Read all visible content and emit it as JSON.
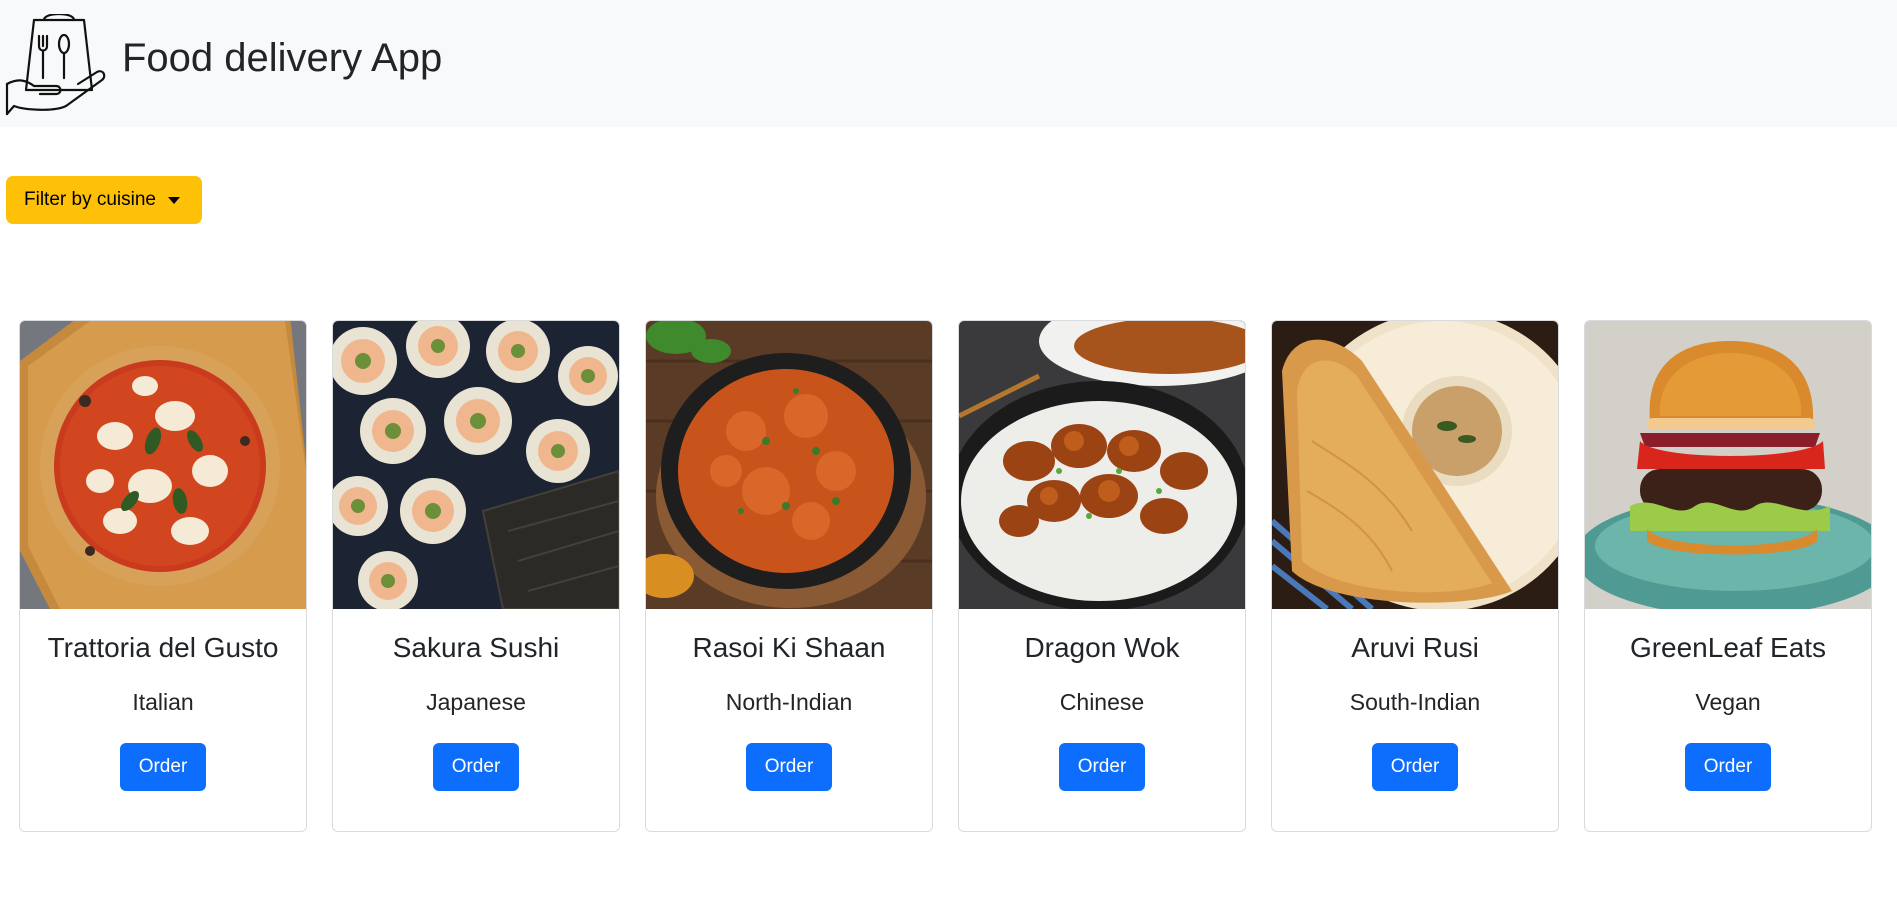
{
  "navbar": {
    "title": "Food delivery App",
    "logo_icon": "hand-holding-food-bag-icon"
  },
  "filter": {
    "label": "Filter by cuisine",
    "color": "#ffc107"
  },
  "restaurants": [
    {
      "name": "Trattoria del Gusto",
      "cuisine": "Italian",
      "order_label": "Order",
      "image": "pizza-image"
    },
    {
      "name": "Sakura Sushi",
      "cuisine": "Japanese",
      "order_label": "Order",
      "image": "sushi-image"
    },
    {
      "name": "Rasoi Ki Shaan",
      "cuisine": "North-Indian",
      "order_label": "Order",
      "image": "curry-image"
    },
    {
      "name": "Dragon Wok",
      "cuisine": "Chinese",
      "order_label": "Order",
      "image": "orange-chicken-image"
    },
    {
      "name": "Aruvi Rusi",
      "cuisine": "South-Indian",
      "order_label": "Order",
      "image": "dosa-image"
    },
    {
      "name": "GreenLeaf Eats",
      "cuisine": "Vegan",
      "order_label": "Order",
      "image": "burger-image"
    }
  ],
  "colors": {
    "navbar_bg": "#f8f9fa",
    "order_button": "#0d6efd",
    "card_border": "#d9dbde"
  }
}
